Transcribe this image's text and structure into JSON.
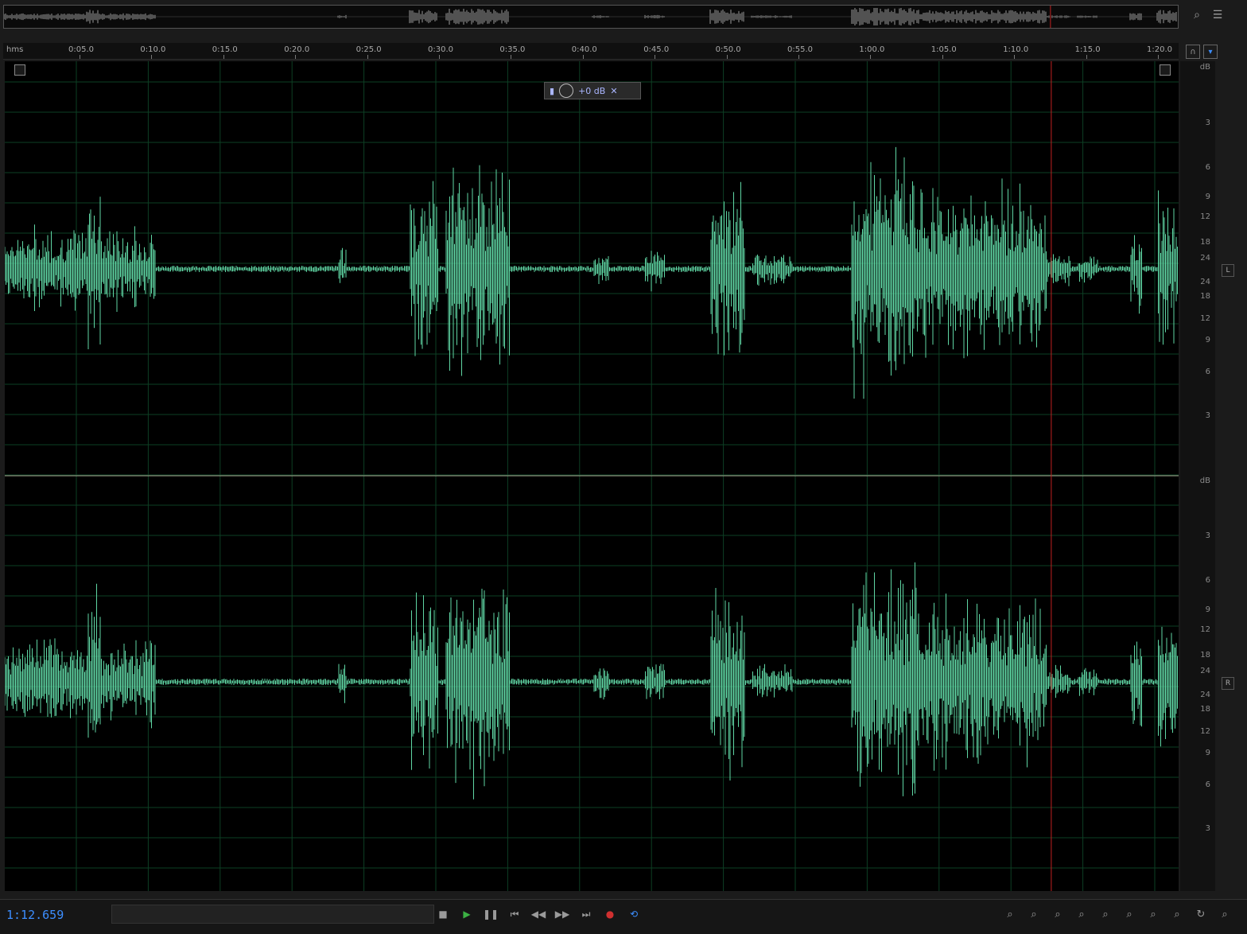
{
  "ruler": {
    "unit": "hms",
    "ticks": [
      "0:05.0",
      "0:10.0",
      "0:15.0",
      "0:20.0",
      "0:25.0",
      "0:30.0",
      "0:35.0",
      "0:40.0",
      "0:45.0",
      "0:50.0",
      "0:55.0",
      "1:00.0",
      "1:05.0",
      "1:10.0",
      "1:15.0",
      "1:20.0"
    ]
  },
  "hud": {
    "gain_label": "+0 dB"
  },
  "db_scale": {
    "unit": "dB",
    "top_channel": [
      "3",
      "6",
      "9",
      "12",
      "18",
      "24",
      "24",
      "18",
      "12",
      "9",
      "6",
      "3"
    ],
    "bottom_channel": [
      "3",
      "6",
      "9",
      "12",
      "18",
      "24",
      "24",
      "18",
      "12",
      "9",
      "6",
      "3"
    ]
  },
  "channels": {
    "left": "L",
    "right": "R"
  },
  "transport": {
    "current_time": "1:12.659"
  },
  "playhead": {
    "time_seconds": 72.659,
    "duration_seconds": 81.5
  },
  "colors": {
    "waveform": "#5fd6a4",
    "grid": "#0d3f24",
    "playhead": "#c02020",
    "time": "#3c8eff"
  },
  "icons": {
    "overview_zoom": "magnifier-icon",
    "menu": "hamburger-icon",
    "snap": "magnet-icon",
    "marker": "marker-icon",
    "stop": "stop-icon",
    "play": "play-icon",
    "pause": "pause-icon",
    "to_start": "skip-back-icon",
    "rewind": "rewind-icon",
    "forward": "fast-forward-icon",
    "to_end": "skip-forward-icon",
    "record": "record-icon",
    "loop": "loop-icon"
  }
}
